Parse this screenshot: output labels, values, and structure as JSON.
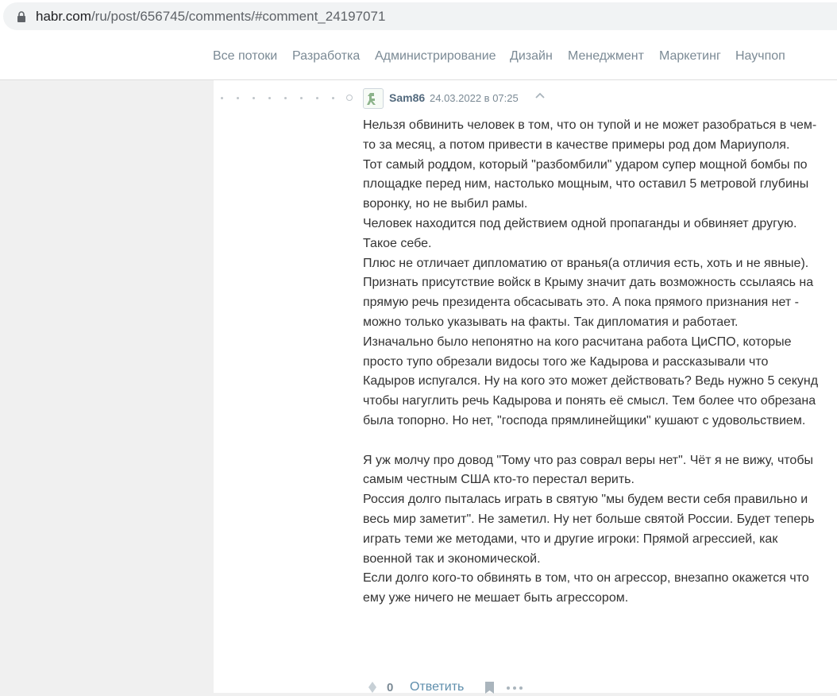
{
  "address_bar": {
    "host": "habr.com",
    "path": "/ru/post/656745/comments/#comment_24197071"
  },
  "nav": {
    "items": [
      "Все потоки",
      "Разработка",
      "Администрирование",
      "Дизайн",
      "Менеджмент",
      "Маркетинг",
      "Научпоп"
    ]
  },
  "comment": {
    "author": "Sam86",
    "date": "24.03.2022 в 07:25",
    "paragraphs": [
      "Нельзя обвинить человек в том, что он тупой и не может разобраться в чем-то за месяц, а потом привести в качестве примеры род дом Мариуполя.",
      "Тот самый роддом, который \"разбомбили\" ударом супер мощной бомбы по площадке перед ним, настолько мощным, что оставил 5 метровой глубины воронку, но не выбил рамы.",
      "Человек находится под действием одной пропаганды и обвиняет другую. Такое себе.",
      "Плюс не отличает дипломатию от вранья(а отличия есть, хоть и не явные). Признать присутствие войск в Крыму значит дать возможность ссылаясь на прямую речь президента обсасывать это. А пока прямого признания нет - можно только указывать на факты. Так дипломатия и работает.",
      "Изначально было непонятно на кого расчитана работа ЦиСПО, которые просто тупо обрезали видосы того же Кадырова и рассказывали что Кадыров испугался. Ну на кого это может действовать? Ведь нужно 5 секунд чтобы нагуглить речь Кадырова и понять её смысл. Тем более что обрезана была топорно. Но нет, \"господа прямлинейщики\" кушают с удовольствием.",
      "",
      "Я уж молчу про довод \"Тому что раз соврал веры нет\". Чёт я не вижу, чтобы самым честным США кто-то перестал верить.",
      "Россия долго пыталась играть в святую \"мы будем вести себя правильно и весь мир заметит\". Не заметил. Ну нет больше святой России. Будет теперь играть теми же методами, что и другие игроки: Прямой агрессией, как военной так и экономической.",
      "Если долго кого-то обвинять в том, что он агрессор, внезапно окажется что ему уже ничего не мешает быть агрессором."
    ],
    "score": "0",
    "reply_label": "Ответить"
  },
  "colors": {
    "nav_text": "#7b8a95",
    "author": "#536a7e",
    "link": "#5e8eac",
    "page_bg": "#f0f0f0"
  },
  "icons": [
    "lock-icon",
    "avatar-icon",
    "chevron-up-icon",
    "vote-icon",
    "bookmark-icon",
    "more-icon"
  ]
}
